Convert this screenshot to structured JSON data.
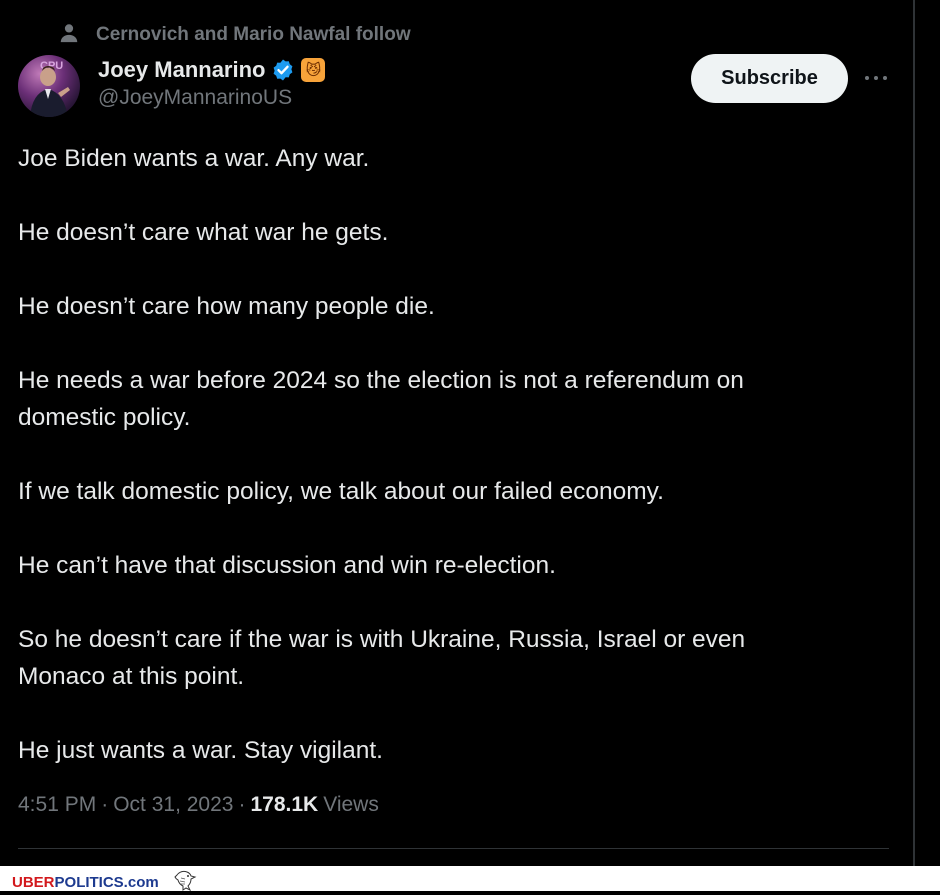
{
  "social_context": {
    "text": "Cernovich and Mario Nawfal follow",
    "icon": "person-icon"
  },
  "author": {
    "name": "Joey Mannarino",
    "handle": "@JoeyMannarinoUS",
    "verified_icon": "verified-badge-icon",
    "emoji": "😼"
  },
  "actions": {
    "subscribe_label": "Subscribe",
    "more_icon": "more-options-icon"
  },
  "tweet": {
    "paragraphs": [
      "Joe Biden wants a war. Any war.",
      "He doesn’t care what war he gets.",
      "He doesn’t care how many people die.",
      "He needs a war before 2024 so the election is not a referendum on",
      "domestic policy.",
      "If we talk domestic policy, we talk about our failed economy.",
      "He can’t have that discussion and win re-election.",
      "So he doesn’t care if the war is with Ukraine, Russia, Israel or even",
      "Monaco at this point.",
      "He just wants a war. Stay vigilant."
    ]
  },
  "meta": {
    "time": "4:51 PM",
    "dot1": "·",
    "date": "Oct 31, 2023",
    "dot2": "·",
    "views_count": "178.1K",
    "views_label": "Views"
  },
  "watermark": {
    "part_a": "UBER",
    "part_b": "POLITICS.com"
  },
  "colors": {
    "background": "#000000",
    "text_primary": "#e7e9ea",
    "text_secondary": "#71767b",
    "verified_blue": "#1d9bf0",
    "button_bg": "#eff3f4"
  }
}
